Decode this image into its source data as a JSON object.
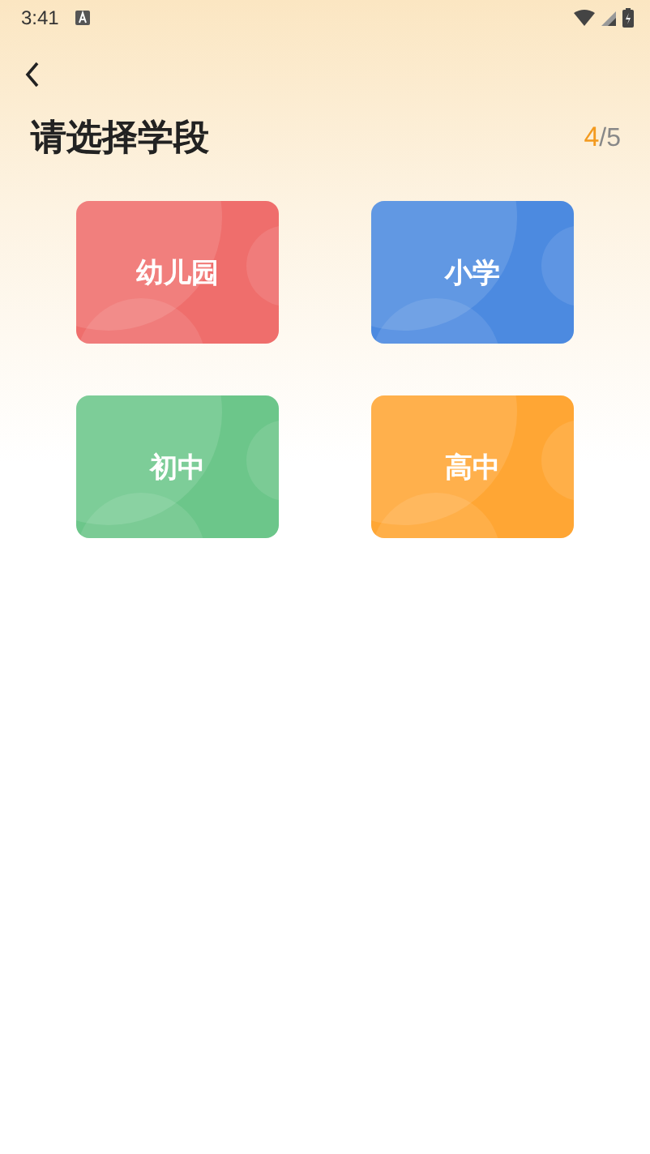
{
  "status_bar": {
    "time": "3:41"
  },
  "header": {
    "title": "请选择学段",
    "step_current": "4",
    "step_total": "/5"
  },
  "stages": [
    {
      "label": "幼儿园",
      "color": "#ef6e6c"
    },
    {
      "label": "小学",
      "color": "#4c8ae0"
    },
    {
      "label": "初中",
      "color": "#6cc68a"
    },
    {
      "label": "高中",
      "color": "#ffa634"
    }
  ]
}
